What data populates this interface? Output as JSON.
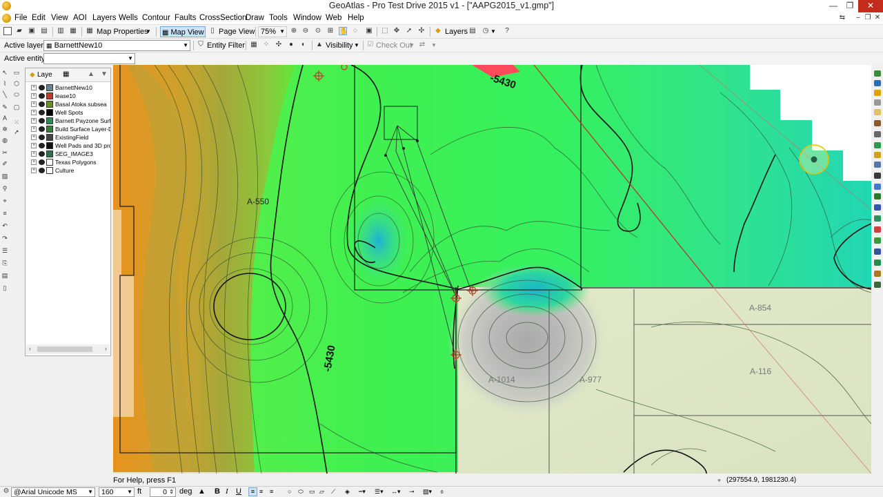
{
  "window": {
    "title": "GeoAtlas - Pro Test Drive 2015 v1 - [\"AAPG2015_v1.gmp\"]",
    "controls": [
      "—",
      "❐",
      "✕"
    ]
  },
  "menu": [
    "File",
    "Edit",
    "View",
    "AOI",
    "Layers",
    "Wells",
    "Contour",
    "Faults",
    "CrossSection",
    "Draw",
    "Tools",
    "Window",
    "Web",
    "Help"
  ],
  "toolbar1": {
    "map_properties": "Map Properties",
    "map_view": "Map View",
    "page_view": "Page View",
    "zoom": "75%",
    "layers": "Layers"
  },
  "toolbar2": {
    "active_layer_label": "Active layer",
    "active_layer_value": "BarnettNew10",
    "entity_filter": "Entity Filter",
    "visibility": "Visibility",
    "check_out": "Check Out"
  },
  "toolbar3": {
    "active_entity_label": "Active entity",
    "active_entity_value": ""
  },
  "layer_panel": {
    "title": "Laye",
    "layers": [
      {
        "name": "BarnettNew10",
        "color": "#6e7f8e"
      },
      {
        "name": "lease10",
        "color": "#c0392b"
      },
      {
        "name": "Basal Atoka subsea",
        "color": "#6b8e23"
      },
      {
        "name": "Well Spots",
        "color": "#000000"
      },
      {
        "name": "Barnett Payzone Surf",
        "color": "#2e8b57"
      },
      {
        "name": "Build Surface Layer-D",
        "color": "#3a7d3a"
      },
      {
        "name": "ExistingField",
        "color": "#444444"
      },
      {
        "name": "Well Pads and 3D pro",
        "color": "#111111"
      },
      {
        "name": "SEG_IMAGE3",
        "color": "#2f6f4f"
      },
      {
        "name": "Texas Polygons",
        "color": "#ffffff"
      },
      {
        "name": "Culture",
        "color": "#ffffff"
      }
    ]
  },
  "map": {
    "contour_labels": [
      "-5430",
      "A-550",
      "-5430",
      "A-854",
      "A-116",
      "A-1014",
      "A-977"
    ]
  },
  "status": {
    "help": "For Help, press F1",
    "coordinates": "(297554.9, 1981230.4)"
  },
  "format_bar": {
    "font": "@Arial Unicode MS",
    "size": "160",
    "unit": "ft",
    "angle": "0",
    "angle_unit": "deg",
    "bold": "B",
    "italic": "I",
    "underline": "U"
  }
}
